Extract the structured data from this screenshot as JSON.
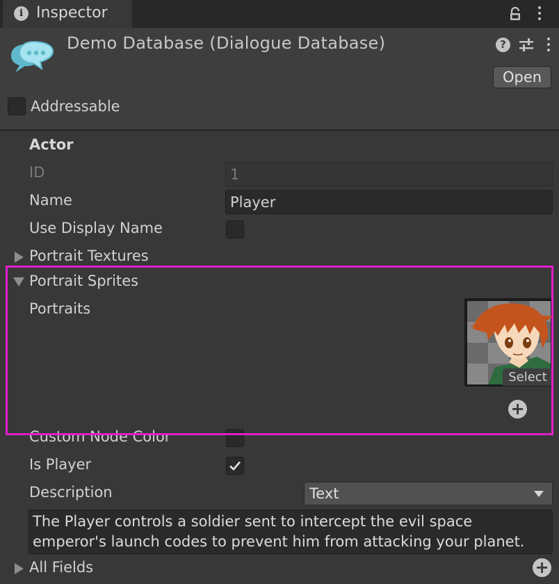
{
  "tab": {
    "label": "Inspector",
    "icon": "info-icon"
  },
  "header": {
    "title": "Demo Database (Dialogue Database)",
    "icon": "dialogue-bubbles-icon",
    "open_label": "Open",
    "addressable_label": "Addressable",
    "addressable_checked": false
  },
  "actor": {
    "section_title": "Actor",
    "id_label": "ID",
    "id_value": "1",
    "name_label": "Name",
    "name_value": "Player",
    "use_display_name_label": "Use Display Name",
    "use_display_name_checked": false,
    "portrait_textures_label": "Portrait Textures",
    "portrait_sprites_label": "Portrait Sprites",
    "portraits_label": "Portraits",
    "select_label": "Select",
    "custom_node_color_label": "Custom Node Color",
    "custom_node_color_checked": false,
    "is_player_label": "Is Player",
    "is_player_checked": true,
    "description_label": "Description",
    "description_type": "Text",
    "description_text": "The Player controls a soldier sent to intercept the evil space emperor's launch codes to prevent him from attacking your planet.",
    "all_fields_label": "All Fields"
  },
  "colors": {
    "background": "#383838",
    "highlight": "#e01ecc",
    "field": "#2a2a2a",
    "logo": "#7fd4e6"
  }
}
